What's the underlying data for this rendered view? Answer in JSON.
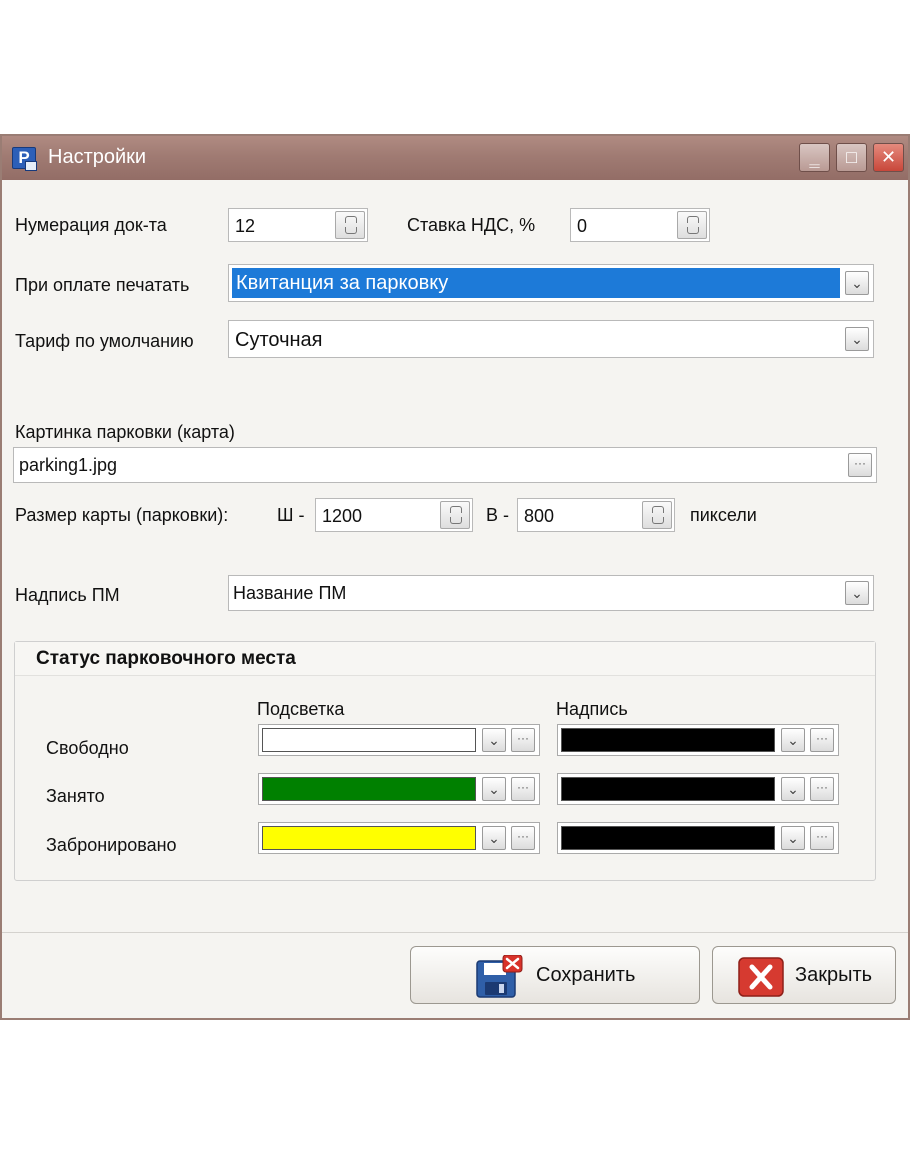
{
  "window": {
    "title": "Настройки",
    "app_icon": "P"
  },
  "titlebar": {
    "minimize": "‗",
    "maximize": "□",
    "close": "✕"
  },
  "doc_numbering": {
    "label": "Нумерация док-та",
    "value": "12"
  },
  "vat": {
    "label": "Ставка НДС, %",
    "value": "0"
  },
  "print_on_payment": {
    "label": "При оплате печатать",
    "value": "Квитанция за парковку"
  },
  "default_tariff": {
    "label": "Тариф по умолчанию",
    "value": "Суточная"
  },
  "parking_image": {
    "label": "Картинка парковки (карта)",
    "value": "parking1.jpg",
    "browse": "···"
  },
  "map_size": {
    "label": "Размер карты (парковки):",
    "width_prefix": "Ш -",
    "width": "1200",
    "height_prefix": "В -",
    "height": "800",
    "unit": "пиксели"
  },
  "pm_caption": {
    "label": "Надпись ПМ",
    "value": "Название ПМ"
  },
  "status_group": {
    "title": "Статус парковочного места",
    "col_highlight": "Подсветка",
    "col_caption": "Надпись",
    "rows": [
      {
        "label": "Свободно",
        "highlight_color": "#ffffff",
        "caption_color": "#000000"
      },
      {
        "label": "Занято",
        "highlight_color": "#008000",
        "caption_color": "#000000"
      },
      {
        "label": "Забронировано",
        "highlight_color": "#ffff00",
        "caption_color": "#000000"
      }
    ]
  },
  "buttons": {
    "save": "Сохранить",
    "close": "Закрыть"
  },
  "icons": {
    "dropdown": "chevron-down-icon",
    "spin": "spin-updown-icon",
    "save": "floppy-disk-icon",
    "close": "red-x-icon"
  }
}
